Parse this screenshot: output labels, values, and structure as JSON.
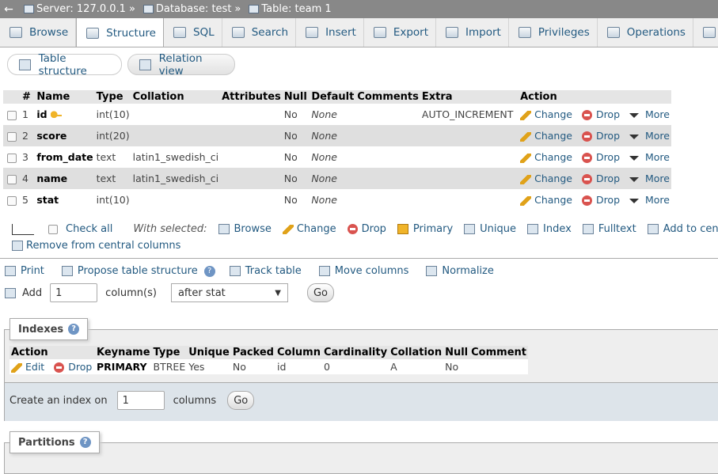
{
  "breadcrumb": {
    "back": "←",
    "server": "Server: 127.0.0.1",
    "database": "Database: test",
    "table": "Table: team 1",
    "sep": "»"
  },
  "tabs": [
    {
      "label": "Browse",
      "icon": "browse-icon"
    },
    {
      "label": "Structure",
      "icon": "structure-icon"
    },
    {
      "label": "SQL",
      "icon": "sql-icon"
    },
    {
      "label": "Search",
      "icon": "search-icon"
    },
    {
      "label": "Insert",
      "icon": "insert-icon"
    },
    {
      "label": "Export",
      "icon": "export-icon"
    },
    {
      "label": "Import",
      "icon": "import-icon"
    },
    {
      "label": "Privileges",
      "icon": "privileges-icon"
    },
    {
      "label": "Operations",
      "icon": "operations-icon"
    },
    {
      "label": "Tr",
      "icon": "tracking-icon"
    }
  ],
  "subtabs": {
    "table_structure": "Table structure",
    "relation_view": "Relation view"
  },
  "structure": {
    "headers": [
      "#",
      "Name",
      "Type",
      "Collation",
      "Attributes",
      "Null",
      "Default",
      "Comments",
      "Extra",
      "Action"
    ],
    "rows": [
      {
        "num": "1",
        "name": "id",
        "type": "int(10)",
        "collation": "",
        "attributes": "",
        "null": "No",
        "default": "None",
        "comments": "",
        "extra": "AUTO_INCREMENT"
      },
      {
        "num": "2",
        "name": "score",
        "type": "int(20)",
        "collation": "",
        "attributes": "",
        "null": "No",
        "default": "None",
        "comments": "",
        "extra": ""
      },
      {
        "num": "3",
        "name": "from_date",
        "type": "text",
        "collation": "latin1_swedish_ci",
        "attributes": "",
        "null": "No",
        "default": "None",
        "comments": "",
        "extra": ""
      },
      {
        "num": "4",
        "name": "name",
        "type": "text",
        "collation": "latin1_swedish_ci",
        "attributes": "",
        "null": "No",
        "default": "None",
        "comments": "",
        "extra": ""
      },
      {
        "num": "5",
        "name": "stat",
        "type": "int(10)",
        "collation": "",
        "attributes": "",
        "null": "No",
        "default": "None",
        "comments": "",
        "extra": ""
      }
    ],
    "actions": {
      "change": "Change",
      "drop": "Drop",
      "more": "More"
    }
  },
  "bulk": {
    "check_all": "Check all",
    "with_selected": "With selected:",
    "browse": "Browse",
    "change": "Change",
    "drop": "Drop",
    "primary": "Primary",
    "unique": "Unique",
    "index": "Index",
    "fulltext": "Fulltext",
    "add_central": "Add to cen",
    "remove_central": "Remove from central columns"
  },
  "tools": {
    "print": "Print",
    "propose": "Propose table structure",
    "track": "Track table",
    "move": "Move columns",
    "normalize": "Normalize"
  },
  "add_columns": {
    "label": "Add",
    "value": "1",
    "unit": "column(s)",
    "position": "after stat",
    "go": "Go"
  },
  "indexes": {
    "legend": "Indexes",
    "headers": [
      "Action",
      "Keyname",
      "Type",
      "Unique",
      "Packed",
      "Column",
      "Cardinality",
      "Collation",
      "Null",
      "Comment"
    ],
    "row": {
      "edit": "Edit",
      "drop": "Drop",
      "keyname": "PRIMARY",
      "type": "BTREE",
      "unique": "Yes",
      "packed": "No",
      "column": "id",
      "cardinality": "0",
      "collation": "A",
      "null": "No",
      "comment": ""
    },
    "create_label": "Create an index on",
    "create_value": "1",
    "create_unit": "columns",
    "go": "Go"
  },
  "partitions": {
    "legend": "Partitions"
  },
  "colors": {
    "link": "#235a81",
    "header_bg": "#888888",
    "row_even": "#dfdfdf"
  }
}
